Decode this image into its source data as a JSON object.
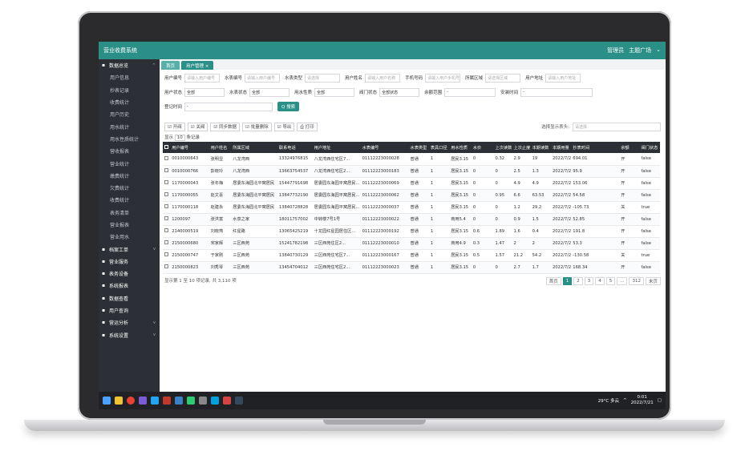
{
  "app": {
    "title": "营业收费系统",
    "user": "管理员",
    "user_menu": "主题广场"
  },
  "sidebar": {
    "items": [
      {
        "label": "数据总览",
        "group": true,
        "caret": "^"
      },
      {
        "label": "用户信息",
        "group": false
      },
      {
        "label": "抄表记录",
        "group": false
      },
      {
        "label": "收费统计",
        "group": false
      },
      {
        "label": "用户历史",
        "group": false
      },
      {
        "label": "用水统计",
        "group": false
      },
      {
        "label": "用水性质统计",
        "group": false
      },
      {
        "label": "营收报表",
        "group": false
      },
      {
        "label": "营业统计",
        "group": false
      },
      {
        "label": "缴费统计",
        "group": false
      },
      {
        "label": "欠费统计",
        "group": false
      },
      {
        "label": "收费统计",
        "group": false
      },
      {
        "label": "表务清单",
        "group": false
      },
      {
        "label": "营业报表",
        "group": false
      },
      {
        "label": "营业用水",
        "group": false
      },
      {
        "label": "档案工单",
        "group": true,
        "caret": "v"
      },
      {
        "label": "营业服务",
        "group": true,
        "caret": ""
      },
      {
        "label": "表务设备",
        "group": true,
        "caret": ""
      },
      {
        "label": "系统报表",
        "group": true,
        "caret": ""
      },
      {
        "label": "数据查看",
        "group": true,
        "caret": ""
      },
      {
        "label": "用户查询",
        "group": true,
        "caret": ""
      },
      {
        "label": "营运分析",
        "group": true,
        "caret": "v"
      },
      {
        "label": "系统设置",
        "group": true,
        "caret": "v"
      }
    ]
  },
  "tabs": [
    {
      "label": "首页"
    },
    {
      "label": "用户管理 ×"
    }
  ],
  "filters": {
    "row1": [
      {
        "label": "用户编号",
        "value": "请输入用户编号"
      },
      {
        "label": "水表编号",
        "value": "请输入用户编号"
      },
      {
        "label": "水表类型",
        "value": "请选择"
      },
      {
        "label": "用户姓名",
        "value": "请输入用户名称"
      },
      {
        "label": "手机号码",
        "value": "请输入用户手机号码"
      },
      {
        "label": "所属区域",
        "value": "请选择区域"
      },
      {
        "label": "用户地址",
        "value": "请输入用户地址"
      }
    ],
    "row2": [
      {
        "label": "用户状态",
        "value": "全部"
      },
      {
        "label": "水表状态",
        "value": "全部"
      },
      {
        "label": "用水性质",
        "value": "全部"
      },
      {
        "label": "阀门状态",
        "value": "全部状态"
      },
      {
        "label": "余额范围",
        "value": "-"
      },
      {
        "label": "安装时间",
        "value": "-"
      }
    ],
    "row3": [
      {
        "label": "登记时间",
        "value": "-"
      }
    ],
    "search_label": "Q 搜索"
  },
  "toolbar": {
    "buttons": [
      "☑ 开阀",
      "☑ 关阀",
      "☑ 同步数据",
      "☑ 批量删除",
      "☑ 导出",
      "⎙ 打印"
    ],
    "right_label": "选择显示表头:",
    "right_value": "请选择"
  },
  "pagesize": {
    "prefix": "显示",
    "value": "10",
    "suffix": "条记录"
  },
  "table": {
    "headers": [
      "用户编号",
      "用户姓名",
      "所属区域",
      "联系电话",
      "用户地址",
      "水表编号",
      "水表类型",
      "表具口径",
      "用水性质",
      "水价",
      "上次读数",
      "上次止度",
      "本期读数",
      "本期用量",
      "抄表时间",
      "余额",
      "阀门状态"
    ],
    "rows": [
      [
        "0010000643",
        "张明显",
        "八龙湾西",
        "13324976815",
        "八龙湾西住宅区7...",
        "01112223000028",
        "普通",
        "1",
        "居民3.15",
        "0",
        "0.32",
        "2.9",
        "19",
        "2022/7/21 3:28:11",
        "694.01",
        "开",
        false
      ],
      [
        "0010000766",
        "彭晓玲",
        "八龙湾西",
        "13663754537",
        "八龙湾西住宅区2...",
        "01112223000183",
        "普通",
        "1",
        "居民3.15",
        "0",
        "0",
        "2.5",
        "1.3",
        "2022/7/21 4:23:01",
        "95.9",
        "开",
        false
      ],
      [
        "1170000043",
        "张冬梅",
        "居委东海园北平窝居民",
        "15447791698",
        "居委园东海园平窝居民...",
        "01112223000069",
        "普通",
        "1",
        "居民3.15",
        "0",
        "0",
        "4.9",
        "4.9",
        "2022/7/21 3:48:03",
        "153.06",
        "开",
        false
      ],
      [
        "1170000055",
        "赵文喜",
        "居委东海园北平窝居民",
        "13847732190",
        "居委园东海园平窝居民...",
        "01112223000062",
        "普通",
        "1",
        "居民3.15",
        "0",
        "0.95",
        "6.6",
        "63.53",
        "2022/7/21 5:30:40",
        "54.58",
        "开",
        false
      ],
      [
        "1170000118",
        "赵建永",
        "居委东海园北平窝居民",
        "13840728828",
        "居委园东海园平窝居民...",
        "01112223000037",
        "普通",
        "1",
        "居民3.15",
        "0",
        "0",
        "1.2",
        "29.2",
        "2022/7/21 3:17:23",
        "-105.73",
        "关",
        true
      ],
      [
        "1200097",
        "张洪富",
        "水泉之家",
        "18011757002",
        "中转楼7号1号",
        "01112223000022",
        "普通",
        "1",
        "商用5.4",
        "0",
        "0",
        "0.9",
        "1.5",
        "2022/7/21 1:57:12",
        "52.85",
        "开",
        false
      ],
      [
        "2140000519",
        "刘晓燕",
        "红星路",
        "13065425219",
        "十龙园红星园居住区...",
        "01112223000192",
        "普通",
        "1",
        "居民3.15",
        "0.6",
        "1.89",
        "1.6",
        "0.4",
        "2022/7/21 3:09:00",
        "191.8",
        "开",
        false
      ],
      [
        "2150000680",
        "宋家辉",
        "三区西苑",
        "15241782198",
        "三区西苑住区2...",
        "01112223000010",
        "普通",
        "1",
        "商用4.9",
        "0.3",
        "1.47",
        "2",
        "2",
        "2022/7/21 0:58:31",
        "53.3",
        "开",
        false
      ],
      [
        "2150000747",
        "于家刚",
        "三区西苑",
        "13840730129",
        "三区西苑住宅区7...",
        "01112223000167",
        "普通",
        "1",
        "居民3.15",
        "0.5",
        "1.57",
        "21.2",
        "54.2",
        "2022/7/21 2:54:43",
        "-130.58",
        "关",
        true
      ],
      [
        "2150000823",
        "刘秀琴",
        "三区西苑",
        "13454704012",
        "三区西苑住宅区2...",
        "01112223000023",
        "普通",
        "1",
        "居民3.15",
        "0",
        "0",
        "2.7",
        "1.7",
        "2022/7/21 2:48:04",
        "168.34",
        "开",
        false
      ]
    ]
  },
  "pager": {
    "summary": "显示第 1 至 10 项记录, 共 3,110 项",
    "pages": [
      "首页",
      "1",
      "2",
      "3",
      "4",
      "5",
      "...",
      "312",
      "末页"
    ],
    "active": "1"
  },
  "taskbar": {
    "weather": "29°C 多云",
    "time": "0:01",
    "date": "2022/7/21"
  },
  "colors": {
    "accent": "#2a8f87",
    "sidebar": "#2c2f35",
    "danger": "#d9342b"
  }
}
